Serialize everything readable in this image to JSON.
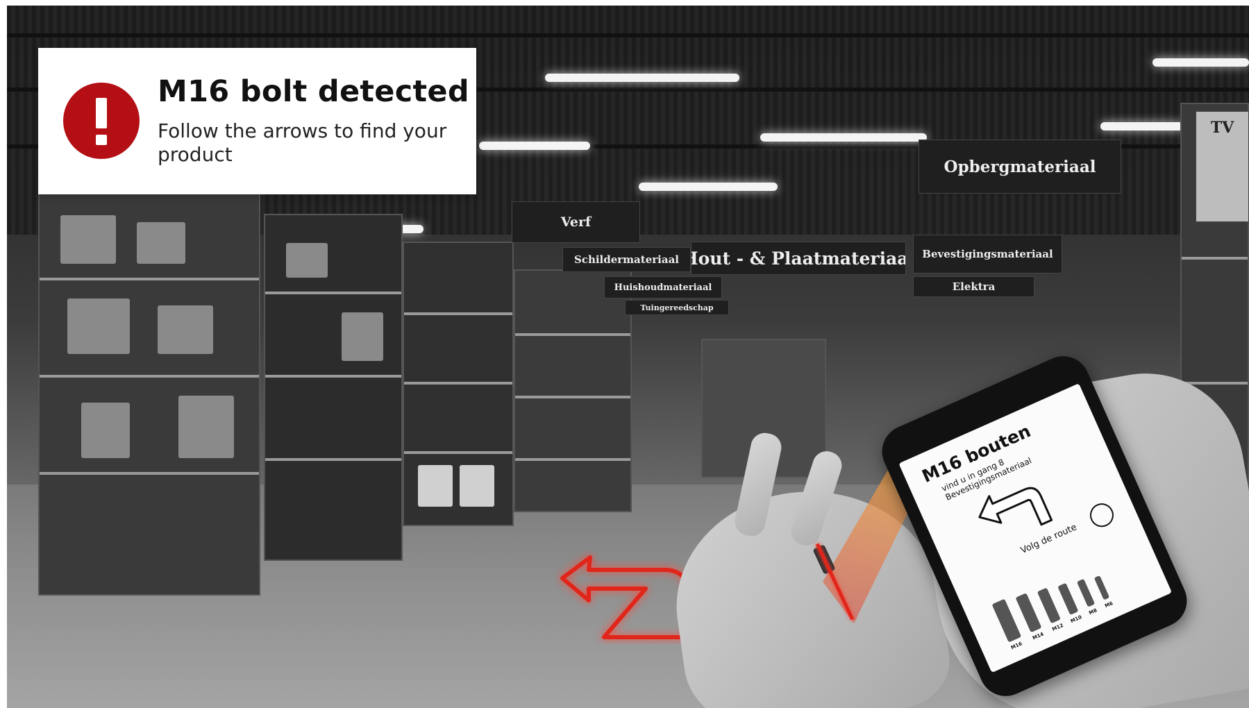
{
  "alert": {
    "icon": "exclamation-icon",
    "icon_color": "#b30f14",
    "title": "M16 bolt detected",
    "message": "Follow the arrows to find your product"
  },
  "store_signs": {
    "verf": "Verf",
    "schildermateriaal": "Schildermateriaal",
    "huishoudmateriaal": "Huishoudmateriaal",
    "tuingereedschap": "Tuingereedschap",
    "hout_plaatmateriaal": "Hout - & Plaatmateriaal",
    "opbergmateriaal": "Opbergmateriaal",
    "bevestigingsmateriaal": "Bevestigingsmateriaal",
    "elektra": "Elektra",
    "tv": "TV"
  },
  "phone": {
    "title": "M16 bouten",
    "subtitle_line1": "vind u in gang 8",
    "subtitle_line2": "Bevestigingsmateriaal",
    "route_label": "Volg de route",
    "bolt_sizes": [
      "M16",
      "M14",
      "M12",
      "M10",
      "M8",
      "M6"
    ]
  },
  "colors": {
    "floor_arrow": "#e0261b",
    "laser": "#e0261b"
  }
}
